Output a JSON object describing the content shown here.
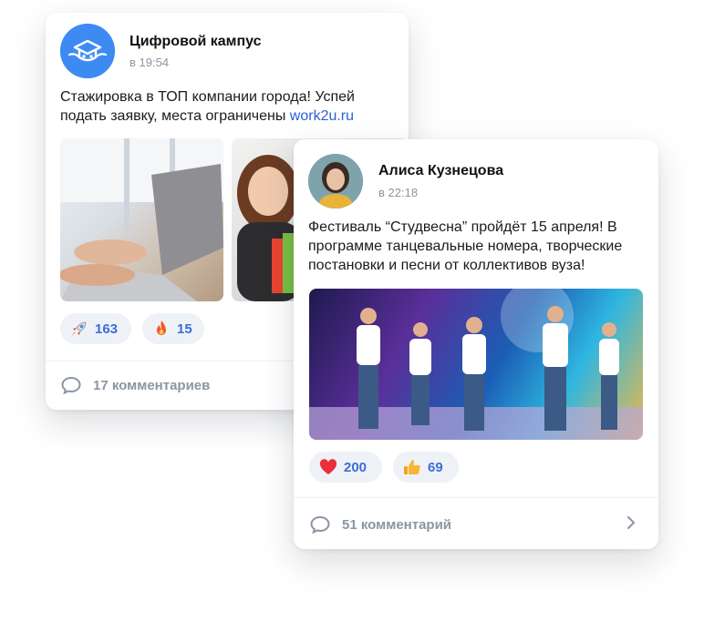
{
  "posts": [
    {
      "author": "Цифровой кампус",
      "time": "в 19:54",
      "text": "Стажировка в ТОП компании города! Успей подать заявку, места ограничены ",
      "link": "work2u.ru",
      "reactions": [
        {
          "icon": "rocket-icon",
          "count": "163"
        },
        {
          "icon": "fire-icon",
          "count": "15"
        }
      ],
      "comments": "17 комментариев"
    },
    {
      "author": "Алиса Кузнецова",
      "time": "в 22:18",
      "text": "Фестиваль “Студвесна” пройдёт 15 апреля! В программе танцевальные номера, творческие постановки и песни от коллективов вуза!",
      "reactions": [
        {
          "icon": "heart-icon",
          "count": "200"
        },
        {
          "icon": "thumbs-up-icon",
          "count": "69"
        }
      ],
      "comments": "51 комментарий"
    }
  ],
  "colors": {
    "link": "#2a5fd7",
    "reaction_count": "#3a6ed8",
    "reaction_bg": "#eef2f7",
    "muted": "#8a96a3",
    "campus_avatar": "#3d8bf2"
  }
}
